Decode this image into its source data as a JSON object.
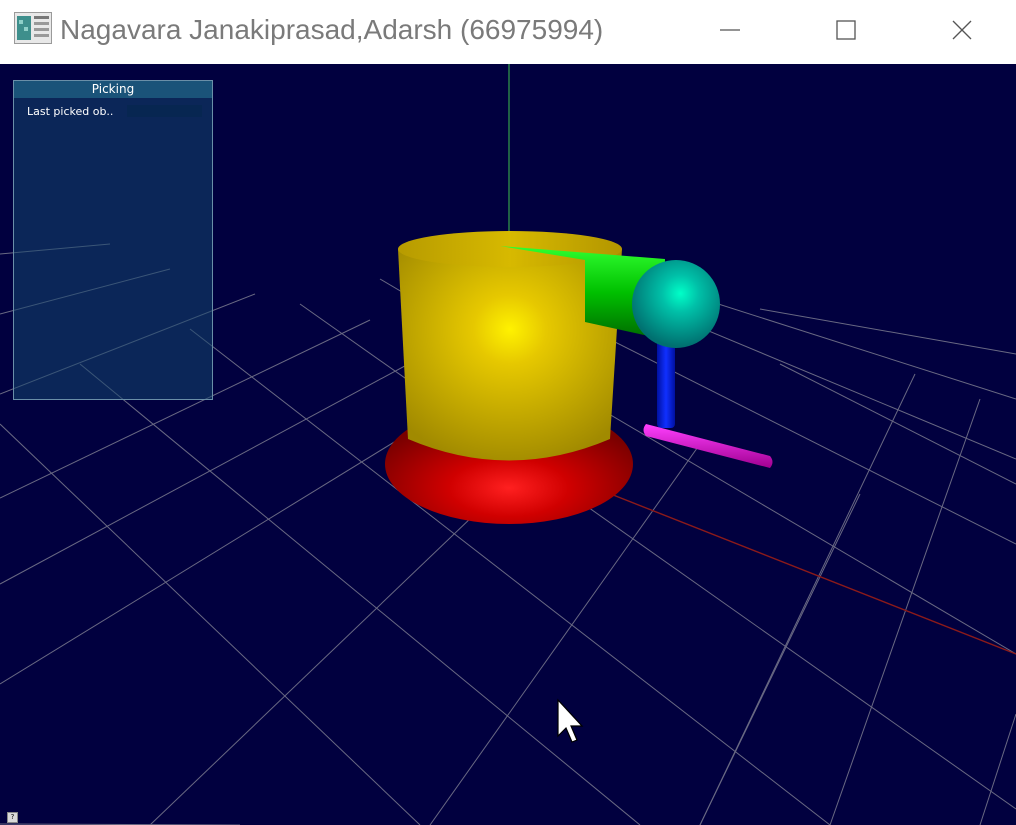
{
  "window": {
    "title": "Nagavara Janakiprasad,Adarsh (66975994)",
    "minimize_label": "—",
    "maximize_label": "☐",
    "close_label": "✕"
  },
  "scene": {
    "background_color": "#01003f",
    "grid_color": "#8c8c9a",
    "objects": [
      {
        "name": "base-disc",
        "color": "#e00000"
      },
      {
        "name": "body-cylinder",
        "color": "#d4b800"
      },
      {
        "name": "arm-cylinder",
        "color": "#00c000"
      },
      {
        "name": "joint-sphere",
        "color": "#00c8a8"
      },
      {
        "name": "vertical-link",
        "color": "#0010d0"
      },
      {
        "name": "end-link",
        "color": "#d000b0"
      }
    ]
  },
  "picking_panel": {
    "title": "Picking",
    "label": "Last picked ob.."
  },
  "help_button_label": "?"
}
